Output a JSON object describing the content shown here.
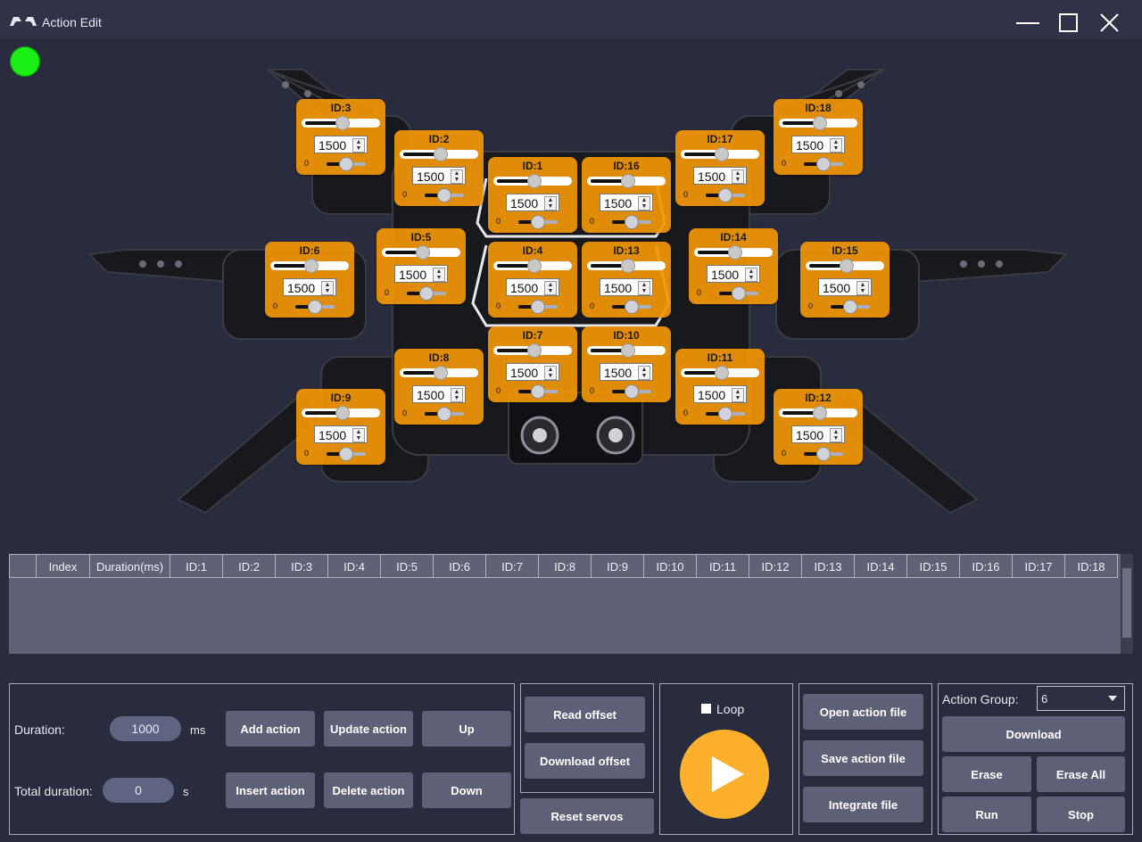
{
  "window": {
    "title": "Action Edit"
  },
  "status": {
    "color": "#1bf016"
  },
  "servos": [
    {
      "id_label": "ID:3",
      "value": "1500",
      "min": "0"
    },
    {
      "id_label": "ID:2",
      "value": "1500",
      "min": "0"
    },
    {
      "id_label": "ID:1",
      "value": "1500",
      "min": "0"
    },
    {
      "id_label": "ID:16",
      "value": "1500",
      "min": "0"
    },
    {
      "id_label": "ID:17",
      "value": "1500",
      "min": "0"
    },
    {
      "id_label": "ID:18",
      "value": "1500",
      "min": "0"
    },
    {
      "id_label": "ID:6",
      "value": "1500",
      "min": "0"
    },
    {
      "id_label": "ID:5",
      "value": "1500",
      "min": "0"
    },
    {
      "id_label": "ID:4",
      "value": "1500",
      "min": "0"
    },
    {
      "id_label": "ID:13",
      "value": "1500",
      "min": "0"
    },
    {
      "id_label": "ID:14",
      "value": "1500",
      "min": "0"
    },
    {
      "id_label": "ID:15",
      "value": "1500",
      "min": "0"
    },
    {
      "id_label": "ID:7",
      "value": "1500",
      "min": "0"
    },
    {
      "id_label": "ID:10",
      "value": "1500",
      "min": "0"
    },
    {
      "id_label": "ID:8",
      "value": "1500",
      "min": "0"
    },
    {
      "id_label": "ID:11",
      "value": "1500",
      "min": "0"
    },
    {
      "id_label": "ID:9",
      "value": "1500",
      "min": "0"
    },
    {
      "id_label": "ID:12",
      "value": "1500",
      "min": "0"
    }
  ],
  "table": {
    "columns": [
      "",
      "Index",
      "Duration(ms)",
      "ID:1",
      "ID:2",
      "ID:3",
      "ID:4",
      "ID:5",
      "ID:6",
      "ID:7",
      "ID:8",
      "ID:9",
      "ID:10",
      "ID:11",
      "ID:12",
      "ID:13",
      "ID:14",
      "ID:15",
      "ID:16",
      "ID:17",
      "ID:18"
    ],
    "rows": []
  },
  "edit": {
    "duration_label": "Duration:",
    "duration_value": "1000",
    "duration_unit": "ms",
    "total_label": "Total duration:",
    "total_value": "0",
    "total_unit": "s",
    "add_action": "Add action",
    "update_action": "Update action",
    "up": "Up",
    "insert_action": "Insert action",
    "delete_action": "Delete action",
    "down": "Down"
  },
  "offset": {
    "read_offset": "Read offset",
    "download_offset": "Download offset",
    "reset_servos": "Reset servos"
  },
  "playback": {
    "loop_label": "Loop",
    "loop_checked": false
  },
  "files": {
    "open": "Open action file",
    "save": "Save action file",
    "integrate": "Integrate file"
  },
  "group": {
    "label": "Action Group:",
    "selected": "6",
    "download": "Download",
    "erase": "Erase",
    "erase_all": "Erase All",
    "run": "Run",
    "stop": "Stop"
  }
}
